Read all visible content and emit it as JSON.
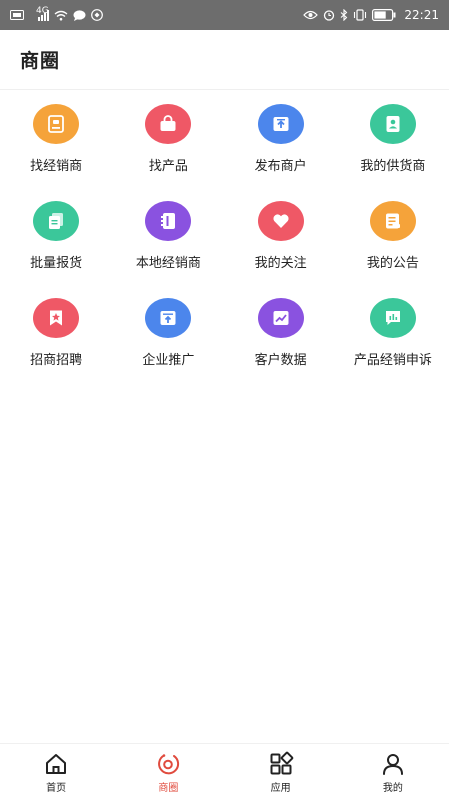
{
  "status_bar": {
    "network_label": "4G",
    "time": "22:21",
    "battery_level_percent": 70
  },
  "header": {
    "title": "商圈"
  },
  "colors": {
    "orange": "#f5a33a",
    "red": "#ef5866",
    "blue": "#4c86ec",
    "teal": "#3bc79a",
    "purple": "#8a52e0",
    "active_tab": "#e04b3e"
  },
  "grid": {
    "items": [
      {
        "label": "找经销商",
        "icon": "contact-card-icon",
        "color": "#f5a33a"
      },
      {
        "label": "找产品",
        "icon": "shopping-bag-icon",
        "color": "#ef5866"
      },
      {
        "label": "发布商户",
        "icon": "upload-box-icon",
        "color": "#4c86ec"
      },
      {
        "label": "我的供货商",
        "icon": "person-card-icon",
        "color": "#3bc79a"
      },
      {
        "label": "批量报货",
        "icon": "documents-icon",
        "color": "#3bc79a"
      },
      {
        "label": "本地经销商",
        "icon": "address-book-icon",
        "color": "#8a52e0"
      },
      {
        "label": "我的关注",
        "icon": "heart-icon",
        "color": "#ef5866"
      },
      {
        "label": "我的公告",
        "icon": "notice-icon",
        "color": "#f5a33a"
      },
      {
        "label": "招商招聘",
        "icon": "star-bookmark-icon",
        "color": "#ef5866"
      },
      {
        "label": "企业推广",
        "icon": "promote-icon",
        "color": "#4c86ec"
      },
      {
        "label": "客户数据",
        "icon": "trend-chart-icon",
        "color": "#8a52e0"
      },
      {
        "label": "产品经销申诉",
        "icon": "chat-chart-icon",
        "color": "#3bc79a"
      }
    ]
  },
  "tabbar": {
    "items": [
      {
        "label": "首页",
        "icon": "home-icon",
        "active": false
      },
      {
        "label": "商圈",
        "icon": "circle-swirl-icon",
        "active": true
      },
      {
        "label": "应用",
        "icon": "apps-icon",
        "active": false
      },
      {
        "label": "我的",
        "icon": "person-icon",
        "active": false
      }
    ]
  }
}
